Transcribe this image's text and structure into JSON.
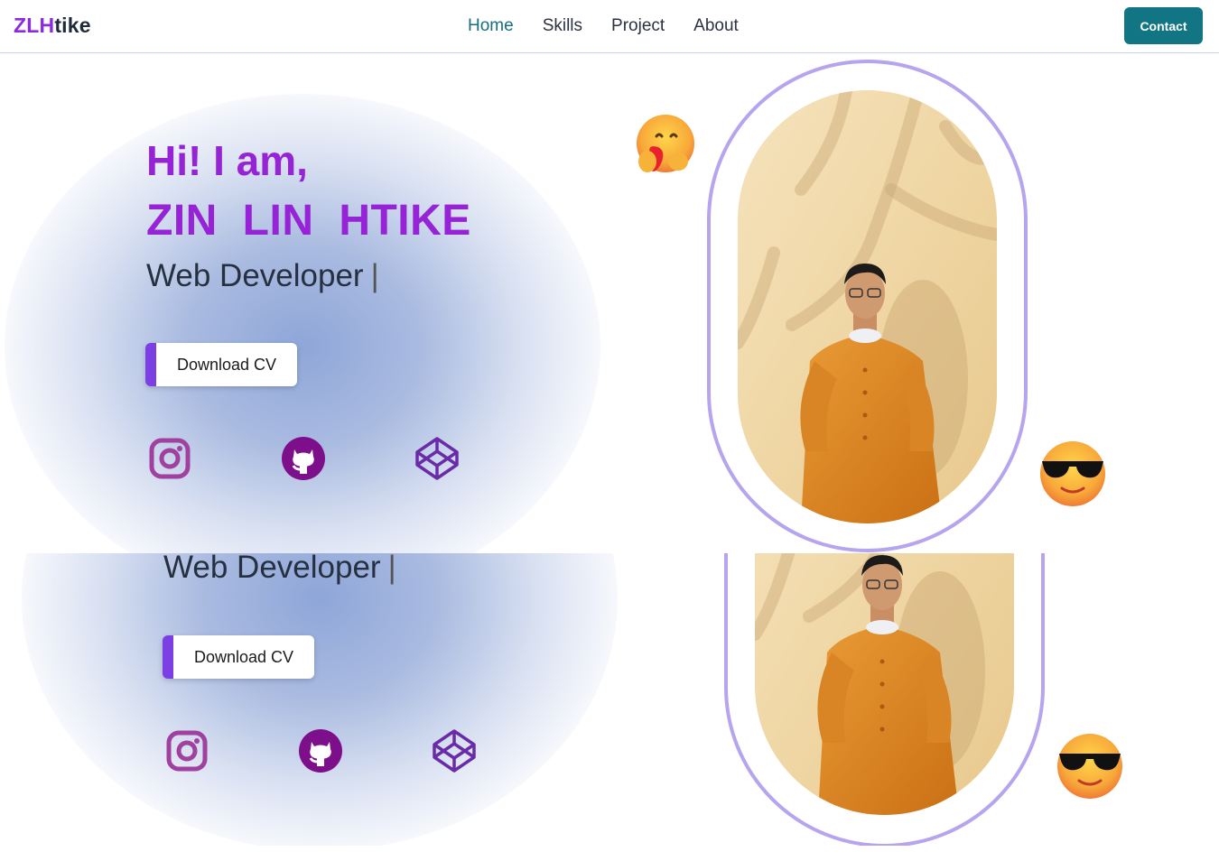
{
  "nav": {
    "brand_highlight": "ZLH",
    "brand_rest": "tike",
    "links": [
      "Home",
      "Skills",
      "Project",
      "About"
    ],
    "active_link": "Home",
    "contact_label": "Contact"
  },
  "hero": {
    "greeting": "Hi! I am,",
    "name": "ZIN LIN HTIKE",
    "role": "Web Developer",
    "caret": "|",
    "download_label": "Download CV",
    "socials": [
      "instagram-icon",
      "github-icon",
      "codepen-icon"
    ]
  },
  "hero_repeat": {
    "role": "Web Developer",
    "caret": "|",
    "download_label": "Download CV"
  },
  "decor": {
    "emojis": [
      "hugging-heart-emoji",
      "sunglasses-emoji"
    ],
    "accent": "#9624d6",
    "frame_color": "#b7a4ee",
    "button_accent": "#7b3fe4",
    "contact_color": "#127584",
    "active_nav_color": "#166e7e"
  }
}
